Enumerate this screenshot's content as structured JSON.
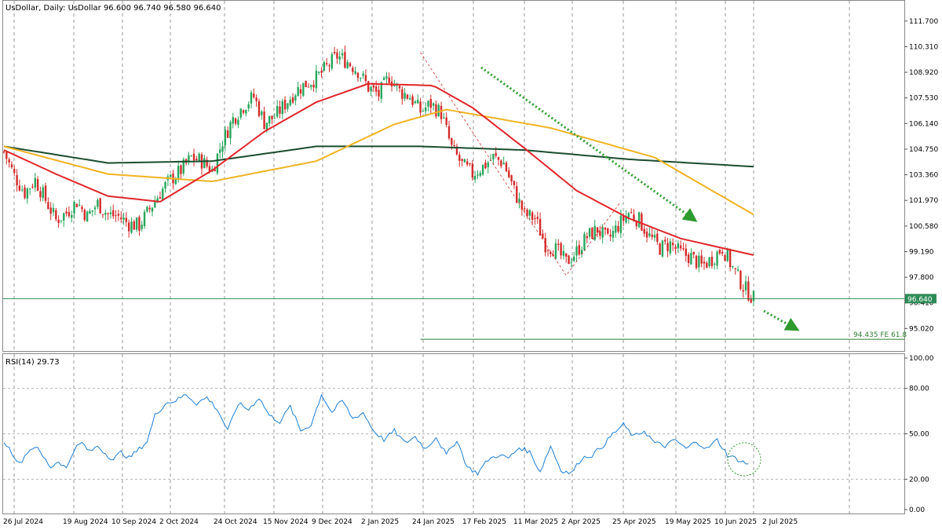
{
  "header": {
    "symbol_line": "UsDollar, Daily:  UsDollar  96.600 96.740 96.580 96.640"
  },
  "rsi_header": "RSI(14) 29.73",
  "colors": {
    "bull": "#26a65b",
    "bear": "#d42a2a",
    "ma_fast": "#e0262a",
    "ma_mid": "#f0b323",
    "ma_slow": "#1b4d2f",
    "rsi": "#1e7fd6",
    "arrow": "#2f9b2f",
    "price_label_bg": "#2e8b57",
    "fe_line": "#2e7d32"
  },
  "chart_data": [
    {
      "type": "candlestick",
      "title": "UsDollar, Daily",
      "ohlc_last": {
        "open": 96.6,
        "high": 96.74,
        "low": 96.58,
        "close": 96.64
      },
      "y_ticks": [
        "111.700",
        "110.310",
        "108.920",
        "107.530",
        "106.140",
        "104.750",
        "103.360",
        "101.970",
        "100.580",
        "99.190",
        "97.800",
        "96.410",
        "95.020"
      ],
      "ylim": [
        93.8,
        112.8
      ],
      "x_tick_labels": [
        "26 Jul 2024",
        "19 Aug 2024",
        "10 Sep 2024",
        "2 Oct 2024",
        "24 Oct 2024",
        "15 Nov 2024",
        "9 Dec 2024",
        "2 Jan 2025",
        "24 Jan 2025",
        "17 Feb 2025",
        "11 Mar 2025",
        "2 Apr 2025",
        "25 Apr 2025",
        "19 May 2025",
        "10 Jun 2025",
        "2 Jul 2025"
      ],
      "close_path": [
        [
          0,
          104.6
        ],
        [
          4,
          103.3
        ],
        [
          8,
          102.4
        ],
        [
          12,
          103.1
        ],
        [
          16,
          102.0
        ],
        [
          20,
          100.9
        ],
        [
          24,
          101.3
        ],
        [
          28,
          101.9
        ],
        [
          32,
          101.1
        ],
        [
          36,
          101.8
        ],
        [
          40,
          101.2
        ],
        [
          44,
          101.1
        ],
        [
          48,
          100.7
        ],
        [
          52,
          100.6
        ],
        [
          56,
          101.5
        ],
        [
          60,
          102.4
        ],
        [
          64,
          103.1
        ],
        [
          68,
          103.6
        ],
        [
          72,
          104.3
        ],
        [
          76,
          104.1
        ],
        [
          80,
          103.6
        ],
        [
          84,
          105.2
        ],
        [
          88,
          106.4
        ],
        [
          92,
          107.1
        ],
        [
          96,
          107.6
        ],
        [
          100,
          106.2
        ],
        [
          104,
          106.5
        ],
        [
          108,
          107.2
        ],
        [
          112,
          107.9
        ],
        [
          116,
          108.3
        ],
        [
          120,
          108.6
        ],
        [
          124,
          109.2
        ],
        [
          128,
          109.8
        ],
        [
          132,
          109.5
        ],
        [
          136,
          109.0
        ],
        [
          140,
          108.1
        ],
        [
          144,
          107.7
        ],
        [
          148,
          108.7
        ],
        [
          152,
          107.9
        ],
        [
          156,
          107.6
        ],
        [
          160,
          106.8
        ],
        [
          164,
          107.2
        ],
        [
          168,
          106.7
        ],
        [
          172,
          104.8
        ],
        [
          176,
          103.9
        ],
        [
          180,
          103.4
        ],
        [
          184,
          103.8
        ],
        [
          188,
          104.3
        ],
        [
          192,
          104.0
        ],
        [
          196,
          102.5
        ],
        [
          200,
          101.2
        ],
        [
          204,
          101.0
        ],
        [
          208,
          99.6
        ],
        [
          212,
          99.3
        ],
        [
          216,
          98.6
        ],
        [
          220,
          99.2
        ],
        [
          224,
          100.0
        ],
        [
          228,
          100.4
        ],
        [
          232,
          99.8
        ],
        [
          236,
          100.6
        ],
        [
          240,
          101.3
        ],
        [
          244,
          100.9
        ],
        [
          248,
          100.0
        ],
        [
          252,
          99.4
        ],
        [
          256,
          99.6
        ],
        [
          260,
          99.1
        ],
        [
          264,
          98.9
        ],
        [
          268,
          98.4
        ],
        [
          272,
          98.8
        ],
        [
          276,
          99.4
        ],
        [
          280,
          98.3
        ],
        [
          284,
          97.3
        ],
        [
          288,
          96.64
        ]
      ],
      "candles_per_day": 1,
      "moving_averages": [
        {
          "key": "ma_slow",
          "values": [
            [
              0,
              104.9
            ],
            [
              40,
              104.0
            ],
            [
              80,
              104.1
            ],
            [
              120,
              104.9
            ],
            [
              160,
              104.9
            ],
            [
              200,
              104.7
            ],
            [
              240,
              104.2
            ],
            [
              288,
              103.8
            ]
          ]
        },
        {
          "key": "ma_mid",
          "values": [
            [
              0,
              104.9
            ],
            [
              40,
              103.4
            ],
            [
              80,
              103.0
            ],
            [
              120,
              104.1
            ],
            [
              150,
              106.1
            ],
            [
              170,
              106.9
            ],
            [
              210,
              105.9
            ],
            [
              250,
              104.3
            ],
            [
              288,
              101.2
            ]
          ]
        },
        {
          "key": "ma_fast",
          "values": [
            [
              0,
              104.7
            ],
            [
              20,
              103.4
            ],
            [
              40,
              102.2
            ],
            [
              60,
              101.9
            ],
            [
              80,
              103.6
            ],
            [
              100,
              105.7
            ],
            [
              120,
              107.3
            ],
            [
              140,
              108.3
            ],
            [
              165,
              108.2
            ],
            [
              180,
              107.0
            ],
            [
              200,
              104.8
            ],
            [
              220,
              102.5
            ],
            [
              240,
              101.0
            ],
            [
              260,
              99.9
            ],
            [
              288,
              99.0
            ]
          ]
        }
      ],
      "current_price": "96.640",
      "target_line": {
        "label": "94.435 FE 61.8",
        "value": 94.435,
        "from_day": 160
      }
    },
    {
      "type": "line",
      "title": "RSI(14) 29.73",
      "y_ticks": [
        "100.00",
        "80.00",
        "50.00",
        "20.00",
        "0.00"
      ],
      "ylim": [
        0,
        100
      ],
      "levels": [
        80,
        50,
        20
      ],
      "series": [
        {
          "values": [
            [
              0,
              45
            ],
            [
              3,
              38
            ],
            [
              6,
              30
            ],
            [
              9,
              38
            ],
            [
              12,
              42
            ],
            [
              15,
              35
            ],
            [
              18,
              28
            ],
            [
              21,
              32
            ],
            [
              24,
              27
            ],
            [
              27,
              40
            ],
            [
              30,
              44
            ],
            [
              33,
              38
            ],
            [
              36,
              42
            ],
            [
              39,
              37
            ],
            [
              42,
              33
            ],
            [
              45,
              38
            ],
            [
              48,
              34
            ],
            [
              52,
              40
            ],
            [
              55,
              45
            ],
            [
              58,
              62
            ],
            [
              62,
              70
            ],
            [
              66,
              72
            ],
            [
              70,
              76
            ],
            [
              74,
              70
            ],
            [
              78,
              74
            ],
            [
              82,
              66
            ],
            [
              86,
              52
            ],
            [
              90,
              70
            ],
            [
              94,
              66
            ],
            [
              98,
              74
            ],
            [
              102,
              62
            ],
            [
              106,
              58
            ],
            [
              110,
              68
            ],
            [
              114,
              52
            ],
            [
              118,
              56
            ],
            [
              122,
              76
            ],
            [
              126,
              64
            ],
            [
              130,
              72
            ],
            [
              134,
              60
            ],
            [
              138,
              64
            ],
            [
              142,
              52
            ],
            [
              146,
              46
            ],
            [
              150,
              52
            ],
            [
              154,
              44
            ],
            [
              158,
              48
            ],
            [
              162,
              40
            ],
            [
              166,
              48
            ],
            [
              170,
              36
            ],
            [
              174,
              46
            ],
            [
              178,
              28
            ],
            [
              182,
              24
            ],
            [
              186,
              33
            ],
            [
              190,
              36
            ],
            [
              194,
              34
            ],
            [
              198,
              41
            ],
            [
              202,
              38
            ],
            [
              206,
              25
            ],
            [
              210,
              42
            ],
            [
              214,
              26
            ],
            [
              218,
              24
            ],
            [
              222,
              34
            ],
            [
              226,
              36
            ],
            [
              230,
              42
            ],
            [
              234,
              50
            ],
            [
              238,
              56
            ],
            [
              242,
              48
            ],
            [
              246,
              52
            ],
            [
              250,
              44
            ],
            [
              254,
              42
            ],
            [
              258,
              46
            ],
            [
              262,
              40
            ],
            [
              266,
              45
            ],
            [
              270,
              40
            ],
            [
              274,
              46
            ],
            [
              278,
              36
            ],
            [
              282,
              33
            ],
            [
              286,
              29.73
            ]
          ]
        }
      ],
      "last_value": 29.73
    }
  ]
}
